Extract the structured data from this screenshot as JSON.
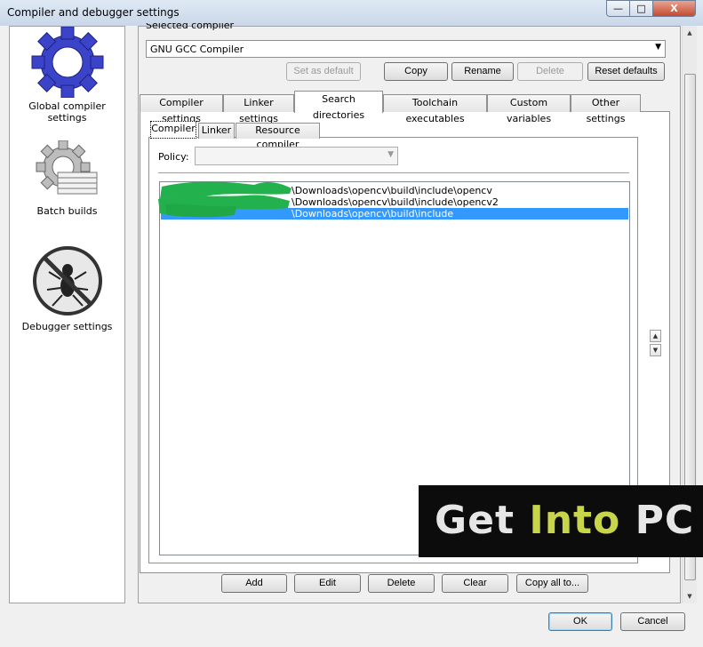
{
  "window": {
    "title": "Compiler and debugger settings",
    "minimize_glyph": "—",
    "maximize_glyph": "□",
    "close_glyph": "X"
  },
  "sidebar": {
    "items": [
      {
        "label": "Global compiler settings",
        "icon": "gear-icon"
      },
      {
        "label": "Batch builds",
        "icon": "batch-gear-icon"
      },
      {
        "label": "Debugger settings",
        "icon": "no-bug-icon"
      }
    ]
  },
  "compiler": {
    "selected_label": "Selected compiler",
    "selected_value": "GNU GCC Compiler",
    "buttons": {
      "set_default": "Set as default",
      "copy": "Copy",
      "rename": "Rename",
      "delete": "Delete",
      "reset": "Reset defaults"
    }
  },
  "tabs": [
    "Compiler settings",
    "Linker settings",
    "Search directories",
    "Toolchain executables",
    "Custom variables",
    "Other settings"
  ],
  "active_tab": "Search directories",
  "subtabs": [
    "Compiler",
    "Linker",
    "Resource compiler"
  ],
  "active_subtab": "Compiler",
  "policy": {
    "label": "Policy:",
    "value": ""
  },
  "directories": [
    "\\Downloads\\opencv\\build\\include\\opencv",
    "\\Downloads\\opencv\\build\\include\\opencv2",
    "\\Downloads\\opencv\\build\\include"
  ],
  "selected_directory_index": 2,
  "list_buttons": {
    "add": "Add",
    "edit": "Edit",
    "delete": "Delete",
    "clear": "Clear",
    "copy_all": "Copy all to..."
  },
  "dialog_buttons": {
    "ok": "OK",
    "cancel": "Cancel"
  },
  "watermark": {
    "get": "Get",
    "into": "Into",
    "pc": "PC"
  },
  "colors": {
    "selection": "#3399ff",
    "scribble": "#22b14c",
    "watermark_accent": "#c8d44a"
  }
}
